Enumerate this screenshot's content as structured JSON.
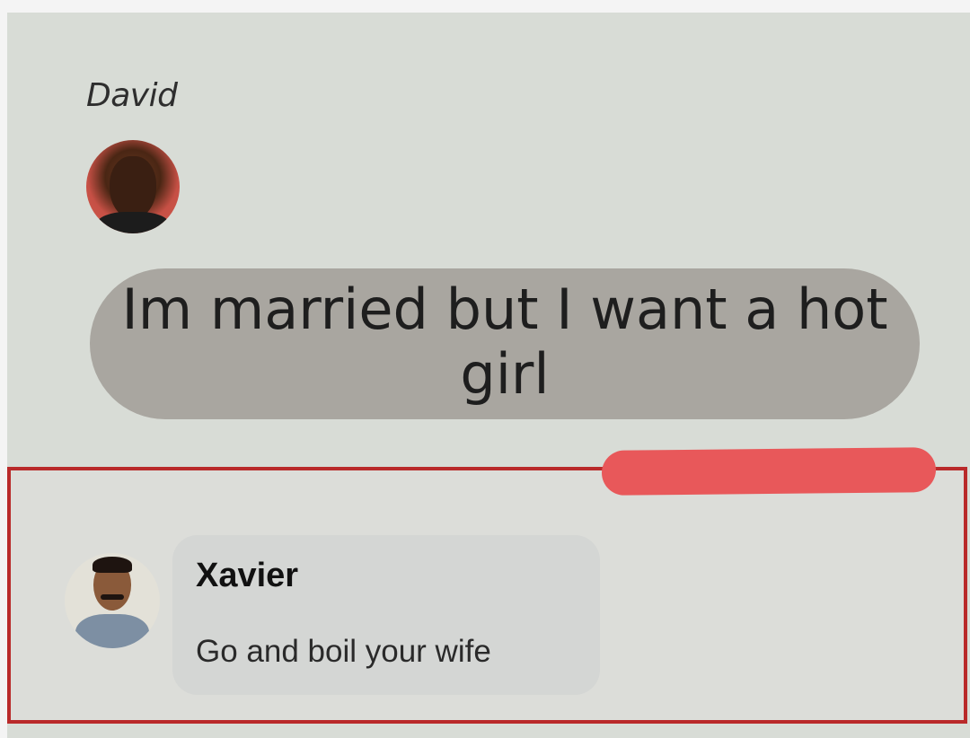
{
  "post": {
    "author": "David",
    "message": "Im married but I want a hot girl"
  },
  "comment": {
    "author": "Xavier",
    "text": "Go and boil your wife"
  },
  "colors": {
    "highlight_border": "#b92a2a",
    "redaction_scribble": "#e8585a",
    "message_bubble": "#a9a6a0",
    "comment_bubble": "#d4d6d4"
  }
}
